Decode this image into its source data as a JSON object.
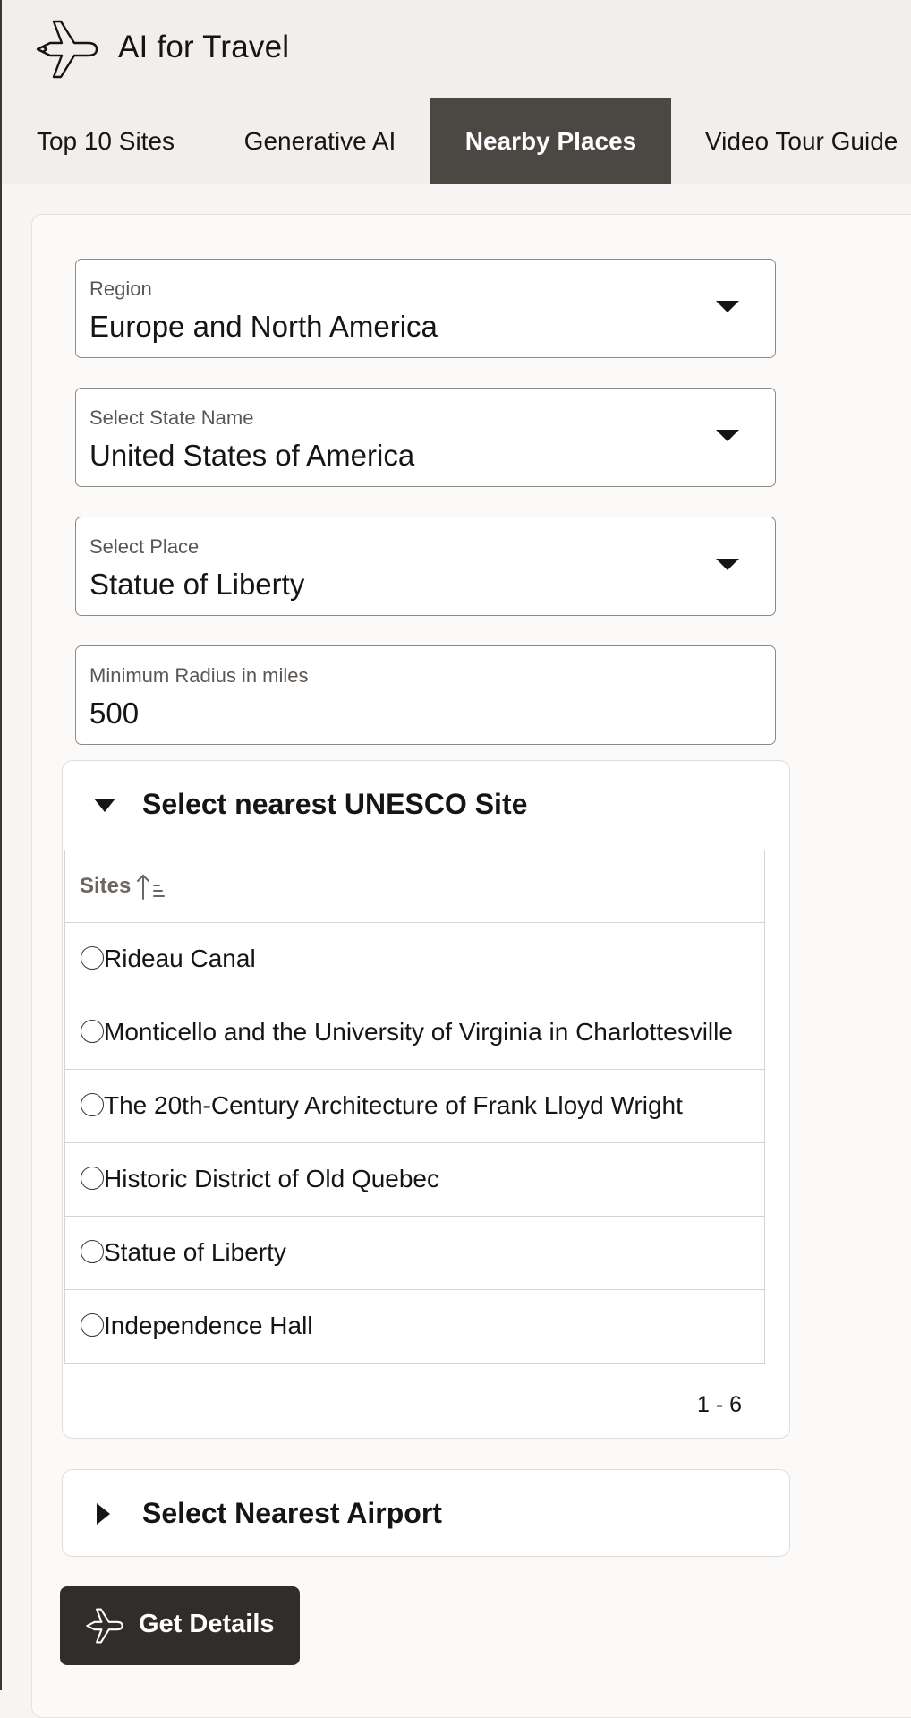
{
  "app": {
    "title": "AI for Travel",
    "logo_icon": "airplane-icon"
  },
  "tabs": [
    {
      "label": "Top 10 Sites",
      "active": false
    },
    {
      "label": "Generative AI",
      "active": false
    },
    {
      "label": "Nearby Places",
      "active": true
    },
    {
      "label": "Video Tour Guide",
      "active": false
    }
  ],
  "form": {
    "region": {
      "label": "Region",
      "value": "Europe and North America"
    },
    "state": {
      "label": "Select State Name",
      "value": "United States of America"
    },
    "place": {
      "label": "Select Place",
      "value": "Statue of Liberty"
    },
    "radius": {
      "label": "Minimum Radius in miles",
      "value": "500"
    }
  },
  "unesco_section": {
    "title": "Select nearest UNESCO Site",
    "expanded": true,
    "column_header": "Sites",
    "rows": [
      {
        "site": "Rideau Canal"
      },
      {
        "site": "Monticello and the University of Virginia in Charlottesville"
      },
      {
        "site": "The 20th-Century Architecture of Frank Lloyd Wright"
      },
      {
        "site": "Historic District of Old Quebec"
      },
      {
        "site": "Statue of Liberty"
      },
      {
        "site": "Independence Hall"
      }
    ],
    "pagination": "1 - 6"
  },
  "airport_section": {
    "title": "Select Nearest Airport",
    "expanded": false
  },
  "action_button": {
    "label": "Get Details",
    "icon": "airplane-icon"
  },
  "colors": {
    "active_tab": "#4b4743",
    "button": "#312d2a",
    "header_bg": "#f1efed"
  }
}
